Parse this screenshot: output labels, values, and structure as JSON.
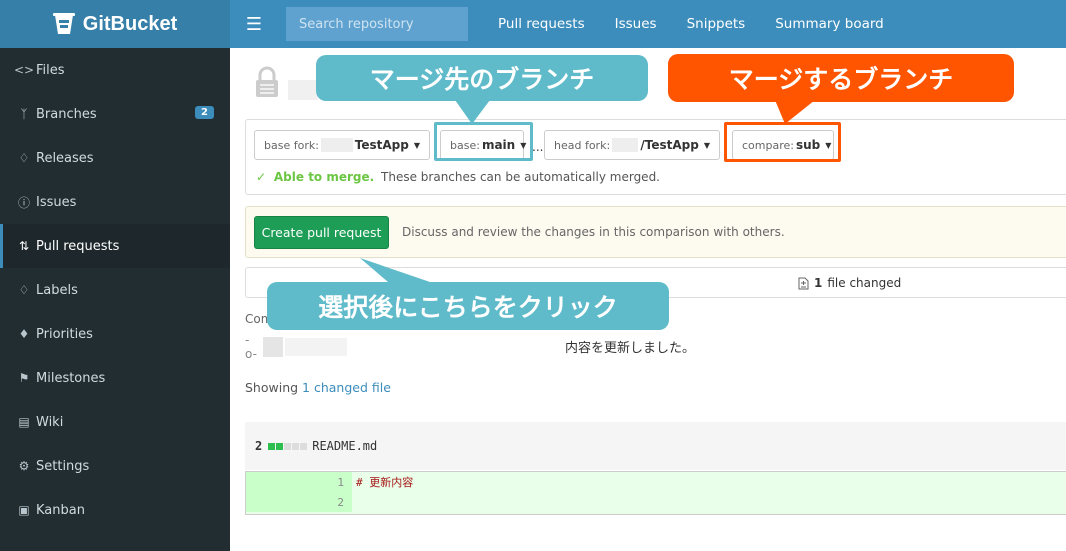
{
  "app": {
    "name": "GitBucket"
  },
  "sidebar": {
    "items": [
      {
        "label": "Files",
        "icon": "code-icon"
      },
      {
        "label": "Branches",
        "icon": "branch-icon",
        "badge": "2"
      },
      {
        "label": "Releases",
        "icon": "tag-icon"
      },
      {
        "label": "Issues",
        "icon": "issue-icon"
      },
      {
        "label": "Pull requests",
        "icon": "pull-request-icon",
        "active": true
      },
      {
        "label": "Labels",
        "icon": "tag-icon"
      },
      {
        "label": "Priorities",
        "icon": "flame-icon"
      },
      {
        "label": "Milestones",
        "icon": "milestone-icon"
      },
      {
        "label": "Wiki",
        "icon": "book-icon"
      },
      {
        "label": "Settings",
        "icon": "gear-icon"
      },
      {
        "label": "Kanban",
        "icon": "inbox-icon"
      }
    ]
  },
  "topnav": {
    "search_placeholder": "Search repository",
    "links": [
      "Pull requests",
      "Issues",
      "Snippets",
      "Summary board"
    ]
  },
  "compare": {
    "base_fork_label": "base fork:",
    "base_fork_repo": "TestApp",
    "base_label": "base:",
    "base_branch": "main",
    "head_fork_label": "head fork:",
    "head_fork_repo": "/TestApp",
    "compare_label": "compare:",
    "compare_branch": "sub",
    "separator": "...",
    "merge_ok": "Able to merge.",
    "merge_desc": "These branches can be automatically merged."
  },
  "pull_request": {
    "button_label": "Create pull request",
    "description": "Discuss and review the changes in this comparison with others."
  },
  "files": {
    "count": "1",
    "changed_label": "file changed"
  },
  "commits": {
    "label": "Com",
    "message": "内容を更新しました。"
  },
  "showing": {
    "prefix": "Showing",
    "link": "1 changed file"
  },
  "diff": {
    "additions": "2",
    "filename": "README.md",
    "lines": [
      {
        "num": "1",
        "text": "# 更新内容"
      },
      {
        "num": "2",
        "text": ""
      }
    ]
  },
  "callouts": {
    "merge_target": "マージ先のブランチ",
    "merge_source": "マージするブランチ",
    "click_after": "選択後にこちらをクリック"
  },
  "colors": {
    "sidebar_bg": "#222d32",
    "topnav_bg": "#3c8dbc",
    "callout_teal": "#5fbbca",
    "callout_orange": "#ff5500",
    "button_green": "#1d9d55"
  }
}
